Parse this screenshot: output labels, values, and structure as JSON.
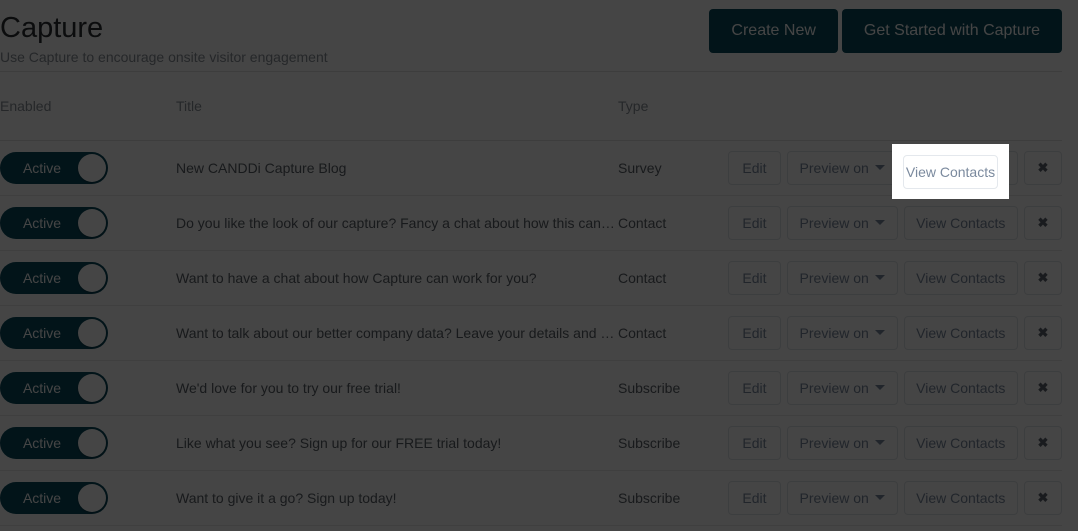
{
  "header": {
    "title": "Capture",
    "subtitle": "Use Capture to encourage onsite visitor engagement",
    "create_new_label": "Create New",
    "get_started_label": "Get Started with Capture"
  },
  "table": {
    "columns": {
      "enabled": "Enabled",
      "title": "Title",
      "type": "Type",
      "actions": ""
    },
    "rows": [
      {
        "enabled_label": "Active",
        "title": "New CANDDi Capture Blog",
        "type": "Survey"
      },
      {
        "enabled_label": "Active",
        "title": "Do you like the look of our capture? Fancy a chat about how this can w…",
        "type": "Contact"
      },
      {
        "enabled_label": "Active",
        "title": "Want to have a chat about how Capture can work for you?",
        "type": "Contact"
      },
      {
        "enabled_label": "Active",
        "title": "Want to talk about our better company data? Leave your details and w…",
        "type": "Contact"
      },
      {
        "enabled_label": "Active",
        "title": "We'd love for you to try our free trial!",
        "type": "Subscribe"
      },
      {
        "enabled_label": "Active",
        "title": "Like what you see? Sign up for our FREE trial today!",
        "type": "Subscribe"
      },
      {
        "enabled_label": "Active",
        "title": "Want to give it a go? Sign up today!",
        "type": "Subscribe"
      }
    ]
  },
  "actions": {
    "edit_label": "Edit",
    "preview_label": "Preview on",
    "view_contacts_label": "View Contacts",
    "delete_label": "✖"
  },
  "spotlight": {
    "target_label": "View Contacts"
  },
  "colors": {
    "brand_teal": "#0a4b5e",
    "overlay": "#454545",
    "muted_text": "#8a9099",
    "button_text": "#7b8a9e",
    "border": "#e2e2e2"
  }
}
